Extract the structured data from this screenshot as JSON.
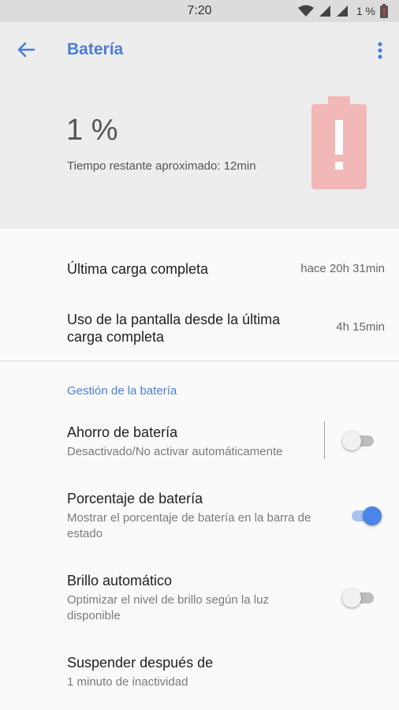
{
  "status_bar": {
    "time": "7:20",
    "battery_percent": "1 %"
  },
  "header": {
    "title": "Batería",
    "battery_level": "1 %",
    "remaining_time": "Tiempo restante aproximado: 12min"
  },
  "stats": [
    {
      "label": "Última carga completa",
      "value": "hace 20h 31min"
    },
    {
      "label": "Uso de la pantalla desde la última carga completa",
      "value": "4h 15min"
    }
  ],
  "section_title": "Gestión de la batería",
  "preferences": [
    {
      "title": "Ahorro de batería",
      "summary": "Desactivado/No activar automáticamente",
      "switch_on": false
    },
    {
      "title": "Porcentaje de batería",
      "summary": "Mostrar el porcentaje de batería en la barra de estado",
      "switch_on": true
    },
    {
      "title": "Brillo automático",
      "summary": "Optimizar el nivel de brillo según la luz disponible",
      "switch_on": false
    },
    {
      "title": "Suspender después de",
      "summary": "1 minuto de inactividad"
    }
  ],
  "colors": {
    "accent": "#4a7fd6",
    "battery_warning": "#f2b8b8"
  }
}
